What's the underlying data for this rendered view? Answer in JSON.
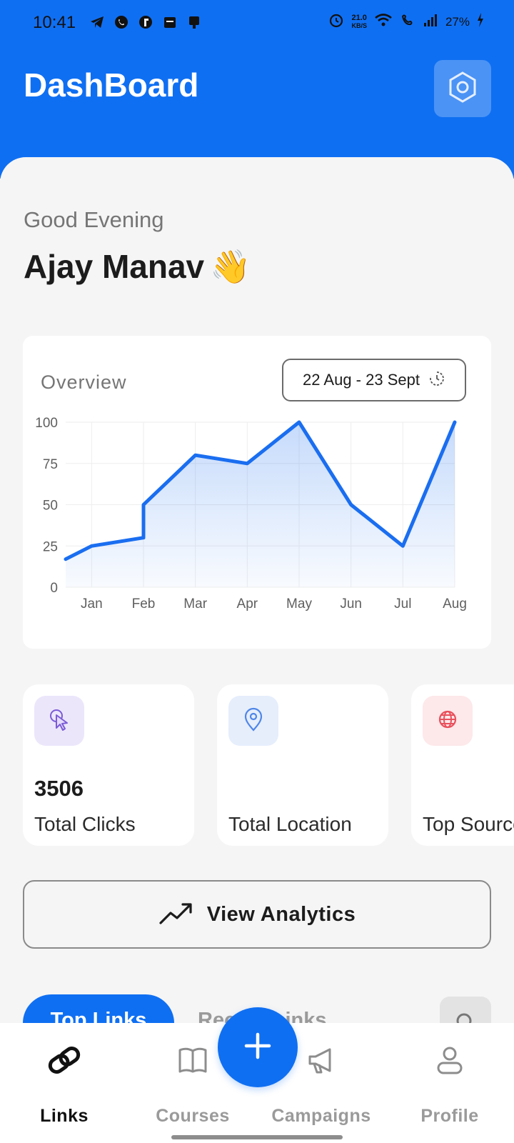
{
  "status_bar": {
    "time": "10:41",
    "net_speed": "21.0",
    "net_unit": "KB/S",
    "battery": "27%"
  },
  "header": {
    "title": "DashBoard",
    "settings_icon": "hexagon-settings-icon"
  },
  "greeting": {
    "salutation": "Good Evening",
    "name": "Ajay Manav",
    "emoji": "👋"
  },
  "overview": {
    "label": "Overview",
    "date_range": "22 Aug - 23 Sept"
  },
  "chart_data": {
    "type": "area",
    "title": "",
    "xlabel": "",
    "ylabel": "",
    "ylim": [
      0,
      100
    ],
    "yticks": [
      0,
      25,
      50,
      75,
      100
    ],
    "xticks": [
      "Jan",
      "Feb",
      "Mar",
      "Apr",
      "May",
      "Jun",
      "Jul",
      "Aug"
    ],
    "grid": true,
    "legend": "none",
    "color": "#1a6ef0",
    "series": [
      {
        "points": [
          {
            "x": 0.5,
            "y": 17
          },
          {
            "x": 1,
            "y": 25
          },
          {
            "x": 2,
            "y": 30
          },
          {
            "x": 2,
            "y": 50
          },
          {
            "x": 3,
            "y": 80
          },
          {
            "x": 4,
            "y": 75
          },
          {
            "x": 5,
            "y": 100
          },
          {
            "x": 6,
            "y": 50
          },
          {
            "x": 7,
            "y": 25
          },
          {
            "x": 8,
            "y": 100
          }
        ]
      }
    ]
  },
  "stats": [
    {
      "value": "3506",
      "label": "Total Clicks",
      "icon": "cursor-click-icon",
      "icon_bg": "#ece6fb",
      "icon_color": "#7b5cd6"
    },
    {
      "value": "",
      "label": "Total Location",
      "icon": "location-pin-icon",
      "icon_bg": "#e6eefc",
      "icon_color": "#4f86e8"
    },
    {
      "value": "",
      "label": "Top Source",
      "icon": "globe-icon",
      "icon_bg": "#fde8ea",
      "icon_color": "#e8505b"
    }
  ],
  "analytics_button": {
    "label": "View Analytics",
    "icon": "trending-up-icon"
  },
  "tabs": {
    "top_links": "Top Links",
    "recent_links": "Recent Links"
  },
  "bottom_nav": {
    "items": [
      {
        "label": "Links",
        "icon": "link-icon",
        "active": true
      },
      {
        "label": "Courses",
        "icon": "book-icon",
        "active": false
      },
      {
        "label": "Campaigns",
        "icon": "megaphone-icon",
        "active": false
      },
      {
        "label": "Profile",
        "icon": "person-icon",
        "active": false
      }
    ],
    "fab_icon": "plus-icon"
  },
  "colors": {
    "primary": "#0f6ff2",
    "background": "#f5f5f5"
  }
}
